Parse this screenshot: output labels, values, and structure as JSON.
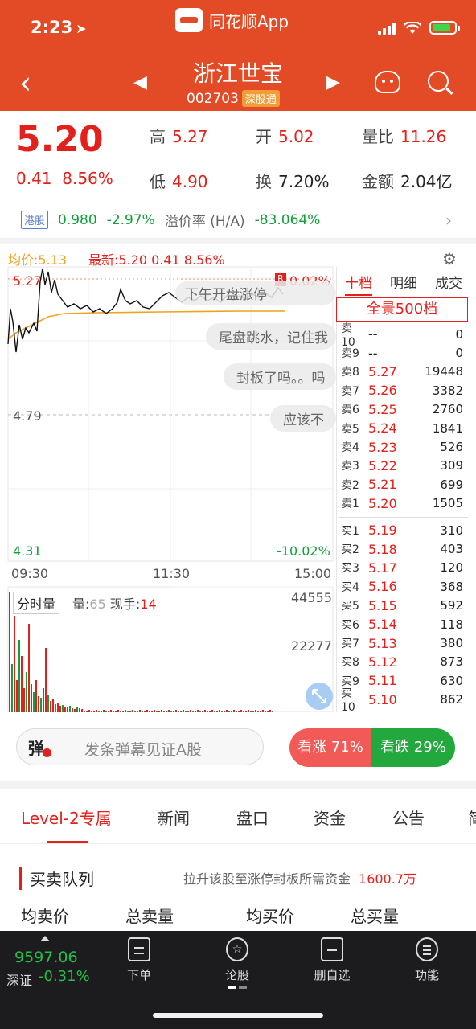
{
  "status_bar": {
    "time": "2:23"
  },
  "app": {
    "name": "同花顺App"
  },
  "stock": {
    "name": "浙江世宝",
    "code": "002703",
    "tag": "深股通"
  },
  "quote": {
    "price": "5.20",
    "change": "0.41",
    "change_pct": "8.56%",
    "high_label": "高",
    "high": "5.27",
    "open_label": "开",
    "open": "5.02",
    "vr_label": "量比",
    "vr": "11.26",
    "low_label": "低",
    "low": "4.90",
    "turnover_label": "换",
    "turnover": "7.20%",
    "amount_label": "金额",
    "amount": "2.04亿"
  },
  "hk": {
    "tag": "港股",
    "price": "0.980",
    "change": "-2.97%",
    "premium_label": "溢价率 (H/A)",
    "premium": "-83.064%"
  },
  "intraday": {
    "avg_label": "均价:5.13",
    "latest_label": "最新:5.20  0.41  8.56%",
    "y_high": "5.27",
    "y_high_pct": "0.02%",
    "y_mid": "4.79",
    "y_low": "4.31",
    "y_low_pct": "-10.02%",
    "times": [
      "09:30",
      "11:30",
      "15:00"
    ],
    "vol_tag": "分时量",
    "vol_label": "量:",
    "vol_value": "65",
    "now_hand_label": "现手:",
    "now_hand": "14",
    "vol_max": "44555",
    "vol_mid": "22277",
    "bubbles": [
      "下午开盘涨停",
      "尾盘跳水，记住我",
      "封板了吗。。吗",
      "应该不"
    ]
  },
  "orderbook": {
    "tabs": [
      "十档",
      "明细",
      "成交"
    ],
    "full_label": "全景500档",
    "asks": [
      {
        "level": "卖10",
        "price": "--",
        "vol": "0"
      },
      {
        "level": "卖9",
        "price": "--",
        "vol": "0"
      },
      {
        "level": "卖8",
        "price": "5.27",
        "vol": "19448"
      },
      {
        "level": "卖7",
        "price": "5.26",
        "vol": "3382"
      },
      {
        "level": "卖6",
        "price": "5.25",
        "vol": "2760"
      },
      {
        "level": "卖5",
        "price": "5.24",
        "vol": "1841"
      },
      {
        "level": "卖4",
        "price": "5.23",
        "vol": "526"
      },
      {
        "level": "卖3",
        "price": "5.22",
        "vol": "309"
      },
      {
        "level": "卖2",
        "price": "5.21",
        "vol": "699"
      },
      {
        "level": "卖1",
        "price": "5.20",
        "vol": "1505"
      }
    ],
    "bids": [
      {
        "level": "买1",
        "price": "5.19",
        "vol": "310"
      },
      {
        "level": "买2",
        "price": "5.18",
        "vol": "403"
      },
      {
        "level": "买3",
        "price": "5.17",
        "vol": "120"
      },
      {
        "level": "买4",
        "price": "5.16",
        "vol": "368"
      },
      {
        "level": "买5",
        "price": "5.15",
        "vol": "592"
      },
      {
        "level": "买6",
        "price": "5.14",
        "vol": "118"
      },
      {
        "level": "买7",
        "price": "5.13",
        "vol": "380"
      },
      {
        "level": "买8",
        "price": "5.12",
        "vol": "873"
      },
      {
        "level": "买9",
        "price": "5.11",
        "vol": "630"
      },
      {
        "level": "买10",
        "price": "5.10",
        "vol": "862"
      }
    ]
  },
  "danmu": {
    "icon_text": "弹",
    "placeholder": "发条弹幕见证A股"
  },
  "vote": {
    "up": "看涨 71%",
    "down": "看跌 29%"
  },
  "tabs": [
    "Level-2专属",
    "新闻",
    "盘口",
    "资金",
    "公告",
    "简"
  ],
  "queue": {
    "title": "买卖队列",
    "note": "拉升该股至涨停封板所需资金",
    "amount": "1600.7万",
    "cols": [
      "均卖价",
      "总卖量",
      "均买价",
      "总买量"
    ]
  },
  "bottom_nav": {
    "index_value": "9597.06",
    "index_name": "深证",
    "index_change": "-0.31%",
    "items": [
      "下单",
      "论股",
      "删自选",
      "功能"
    ]
  },
  "colors": {
    "brand": "#e34a26",
    "up": "#e3211c",
    "down": "#139e3a",
    "avg_line": "#f0a21c"
  }
}
